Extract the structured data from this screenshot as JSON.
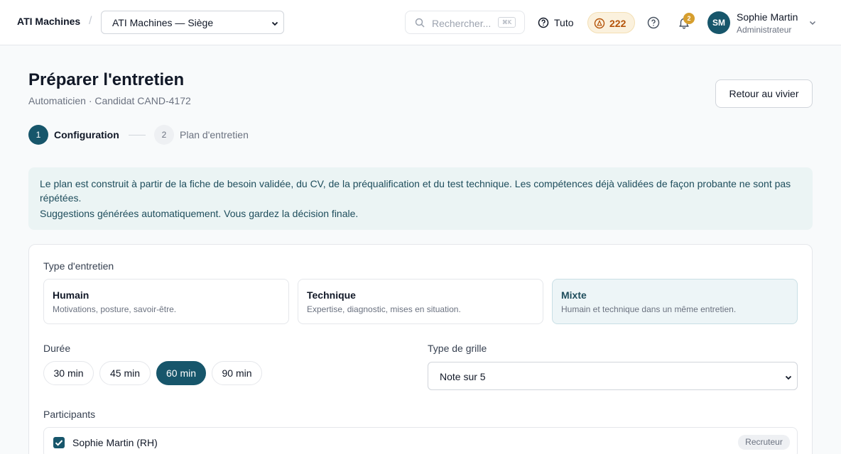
{
  "header": {
    "brand": "ATI Machines",
    "separator": "/",
    "site_select": "ATI Machines — Siège",
    "search_placeholder": "Rechercher...",
    "search_shortcut": "⌘K",
    "tuto_label": "Tuto",
    "credits": "222",
    "notifications_count": "2",
    "user": {
      "initials": "SM",
      "name": "Sophie Martin",
      "role": "Administrateur"
    }
  },
  "page": {
    "title": "Préparer l'entretien",
    "subtitle": "Automaticien · Candidat CAND-4172",
    "back_button": "Retour au vivier"
  },
  "stepper": [
    {
      "number": "1",
      "label": "Configuration",
      "active": true
    },
    {
      "number": "2",
      "label": "Plan d'entretien",
      "active": false
    }
  ],
  "info": {
    "text": "Le plan est construit à partir de la fiche de besoin validée, du CV, de la préqualification et du test technique. Les compétences déjà validées de façon probante ne sont pas répétées.",
    "note": "Suggestions générées automatiquement. Vous gardez la décision finale."
  },
  "form": {
    "interview_type_label": "Type d'entretien",
    "interview_types": [
      {
        "title": "Humain",
        "desc": "Motivations, posture, savoir-être.",
        "selected": false
      },
      {
        "title": "Technique",
        "desc": "Expertise, diagnostic, mises en situation.",
        "selected": false
      },
      {
        "title": "Mixte",
        "desc": "Humain et technique dans un même entretien.",
        "selected": true
      }
    ],
    "duration_label": "Durée",
    "durations": [
      {
        "label": "30 min",
        "selected": false
      },
      {
        "label": "45 min",
        "selected": false
      },
      {
        "label": "60 min",
        "selected": true
      },
      {
        "label": "90 min",
        "selected": false
      }
    ],
    "grid_type_label": "Type de grille",
    "grid_type_value": "Note sur 5",
    "participants_label": "Participants",
    "participants": [
      {
        "name": "Sophie Martin (RH)",
        "role": "Recruteur",
        "checked": true
      }
    ]
  },
  "colors": {
    "primary": "#17566b",
    "info_bg": "#ebf4f4",
    "credits_bg": "#fbf1dd",
    "badge": "#d69e2e"
  }
}
